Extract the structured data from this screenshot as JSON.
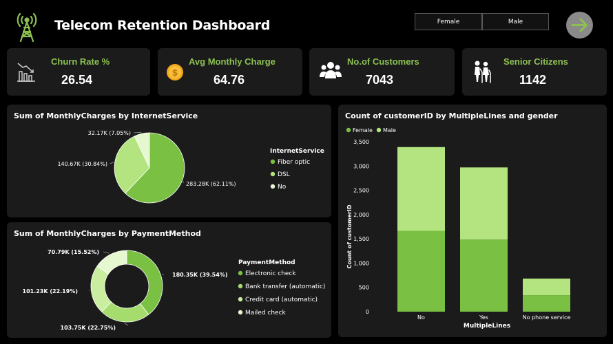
{
  "header": {
    "title": "Telecom Retention Dashboard",
    "slicer": [
      "Female",
      "Male"
    ],
    "icons": {
      "logo": "tower-icon",
      "next": "arrow-right-icon"
    }
  },
  "kpis": [
    {
      "label": "Churn Rate %",
      "value": "26.54",
      "icon": "chart-down-icon"
    },
    {
      "label": "Avg Monthly Charge",
      "value": "64.76",
      "icon": "coin-icon"
    },
    {
      "label": "No.of Customers",
      "value": "7043",
      "icon": "people-icon"
    },
    {
      "label": "Senior Citizens",
      "value": "1142",
      "icon": "seniors-icon"
    }
  ],
  "colors": {
    "accent": "#8cc152",
    "dark_green": "#7ac143",
    "mid_green": "#a6dc6d",
    "light_green": "#c9eea0",
    "pale_green": "#e6f8cf",
    "card": "#1b1b1b"
  },
  "chart_data": [
    {
      "type": "pie",
      "title": "Sum of MonthlyCharges by InternetService",
      "legend_title": "InternetService",
      "legend_position": "right",
      "categories": [
        "Fiber optic",
        "DSL",
        "No"
      ],
      "values": [
        283.28,
        140.67,
        32.17
      ],
      "labels": [
        "283.28K (62.11%)",
        "140.67K (30.84%)",
        "32.17K (7.05%)"
      ],
      "colors": [
        "#7ac143",
        "#b3e47f",
        "#e6f8cf"
      ]
    },
    {
      "type": "pie",
      "title": "Sum of MonthlyCharges by PaymentMethod",
      "legend_title": "PaymentMethod",
      "legend_position": "right",
      "categories": [
        "Electronic check",
        "Bank transfer (automatic)",
        "Credit card (automatic)",
        "Mailed check"
      ],
      "values": [
        180.35,
        103.75,
        101.23,
        70.79
      ],
      "labels": [
        "180.35K (39.54%)",
        "103.75K (22.75%)",
        "101.23K (22.19%)",
        "70.79K (15.52%)"
      ],
      "colors": [
        "#7ac143",
        "#a6dc6d",
        "#c9eea0",
        "#e6f8cf"
      ]
    },
    {
      "type": "bar",
      "title": "Count of customerID by MultipleLines and gender",
      "xlabel": "MultipleLines",
      "ylabel": "Count of customerID",
      "legend_position": "top-left",
      "categories": [
        "No",
        "Yes",
        "No phone service"
      ],
      "series": [
        {
          "name": "Female",
          "values": [
            1665,
            1484,
            339
          ],
          "color": "#7ac143"
        },
        {
          "name": "Male",
          "values": [
            1725,
            1487,
            343
          ],
          "color": "#b3e47f"
        }
      ],
      "ylim": [
        0,
        3500
      ],
      "yticks": [
        "0",
        "500",
        "1,000",
        "1,500",
        "2,000",
        "2,500",
        "3,000",
        "3,500"
      ],
      "stacked": true
    }
  ]
}
